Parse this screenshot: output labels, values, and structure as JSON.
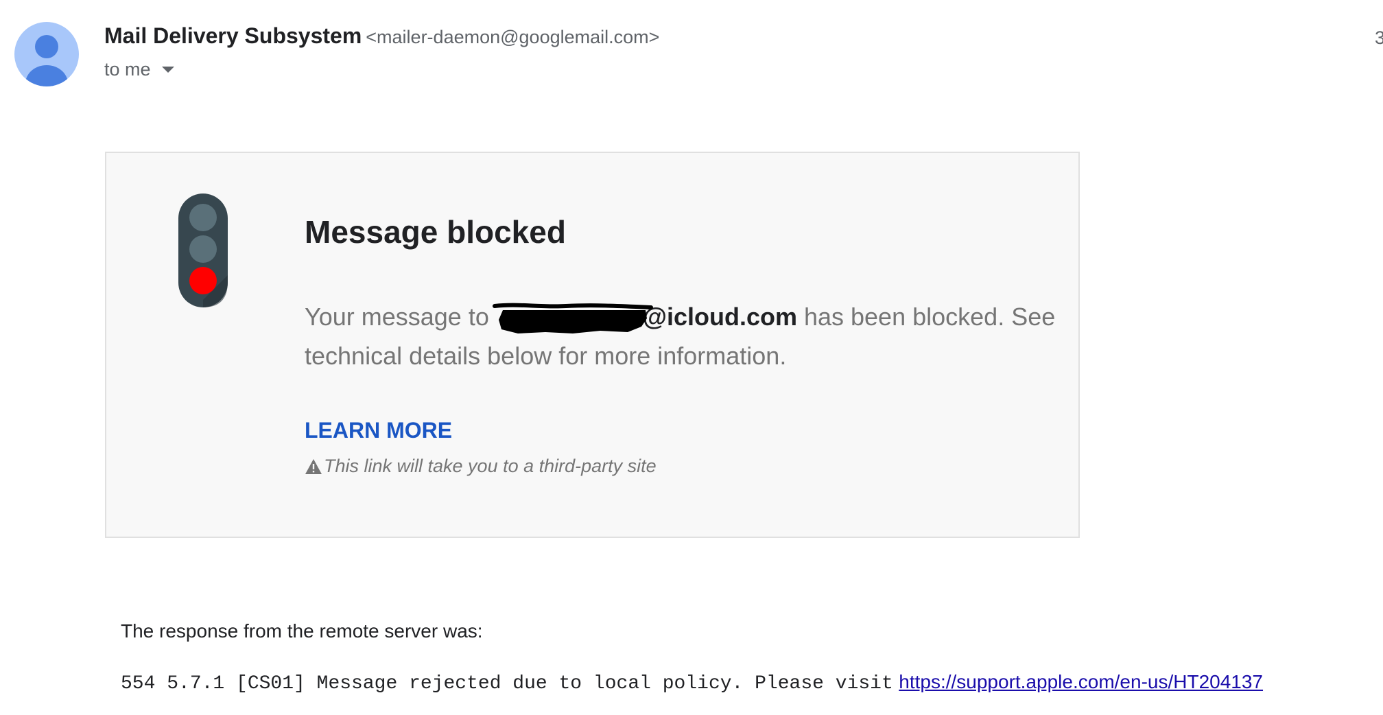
{
  "header": {
    "sender_name": "Mail Delivery Subsystem",
    "sender_email": "<mailer-daemon@googlemail.com>",
    "recipient_label": "to me",
    "time_partial": "3"
  },
  "card": {
    "title": "Message blocked",
    "body_before": "Your message to ",
    "blocked_address": "@icloud.com",
    "body_after": " has been blocked. See technical details below for more information.",
    "learn_more": "LEARN MORE",
    "warning_text": "This link will take you to a third-party site"
  },
  "details": {
    "response_label": "The response from the remote server was:",
    "response_code": "554 5.7.1 [CS01] Message rejected due to local policy. Please visit",
    "response_link": "https://support.apple.com/en-us/HT204137"
  },
  "colors": {
    "link_blue": "#1a56c4",
    "avatar_bg": "#a8c7fa",
    "avatar_fg": "#4a80e0",
    "light_red": "#ff0000",
    "light_off": "#5a7079",
    "light_body": "#37474f"
  },
  "icons": {
    "avatar": "avatar-person-icon",
    "caret": "chevron-down-icon",
    "traffic_light": "traffic-light-icon",
    "warning": "warning-icon"
  }
}
